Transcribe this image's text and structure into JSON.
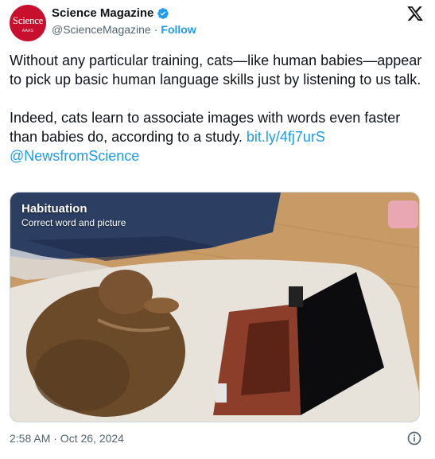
{
  "author": {
    "name": "Science Magazine",
    "handle": "@ScienceMagazine",
    "follow_label": "Follow",
    "avatar_logo": "Science",
    "avatar_sub": "AAAS"
  },
  "tweet": {
    "paragraph1": "Without any particular training, cats—like human babies—appear to pick up basic human language skills just by listening to us talk.",
    "paragraph2_text": "Indeed, cats learn to associate images with words even faster than babies do, according to a study. ",
    "link": "bit.ly/4fj7urS",
    "mention": "@NewsfromScience"
  },
  "media": {
    "overlay_title": "Habituation",
    "overlay_subtitle": "Correct word and picture"
  },
  "footer": {
    "timestamp": "2:58 AM · Oct 26, 2024"
  },
  "icons": {
    "verified": "verified-badge-icon",
    "x_logo": "x-logo-icon",
    "info": "info-icon"
  },
  "colors": {
    "accent": "#1d9bf0",
    "brand_red": "#c8102e",
    "muted": "#536471"
  }
}
